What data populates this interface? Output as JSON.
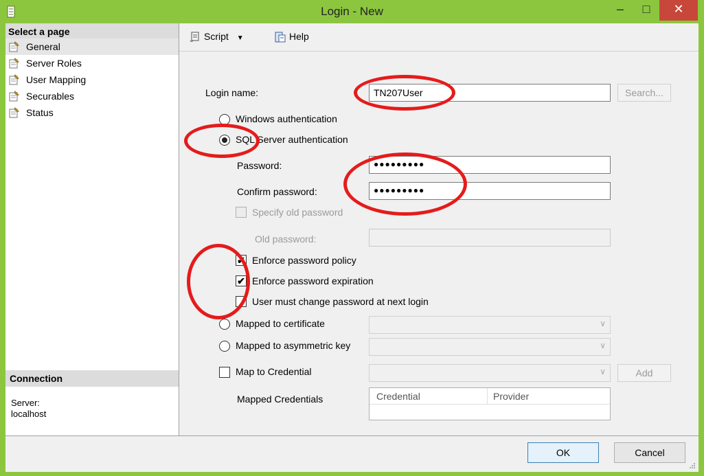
{
  "window": {
    "title": "Login - New",
    "minimize_glyph": "–",
    "maximize_glyph": "□",
    "close_glyph": "✕"
  },
  "left_pane": {
    "header": "Select a page",
    "pages": [
      "General",
      "Server Roles",
      "User Mapping",
      "Securables",
      "Status"
    ],
    "selected": "General",
    "connection_header": "Connection",
    "server_label": "Server:",
    "server_value": "localhost"
  },
  "toolbar": {
    "script_label": "Script",
    "dropdown_glyph": "▼",
    "help_label": "Help"
  },
  "form": {
    "login_name_label": "Login name:",
    "login_name_value": "TN207User",
    "search_button": "Search...",
    "windows_auth_label": "Windows authentication",
    "sql_auth_label": "SQL Server authentication",
    "password_label": "Password:",
    "password_value": "●●●●●●●●●",
    "confirm_password_label": "Confirm password:",
    "confirm_password_value": "●●●●●●●●●",
    "specify_old_password_label": "Specify old password",
    "old_password_label": "Old password:",
    "enforce_policy_label": "Enforce password policy",
    "enforce_expiration_label": "Enforce password expiration",
    "must_change_label": "User must change password at next login",
    "mapped_cert_label": "Mapped to certificate",
    "mapped_asym_label": "Mapped to asymmetric key",
    "map_credential_label": "Map to Credential",
    "add_button": "Add",
    "mapped_credentials_label": "Mapped Credentials",
    "grid_columns": [
      "Credential",
      "Provider"
    ],
    "check_glyph": "✔",
    "combo_arrow": "∨"
  },
  "footer": {
    "ok_button": "OK",
    "cancel_button": "Cancel"
  },
  "colors": {
    "frame": "#8cc63f",
    "close": "#c7483a",
    "annotation": "#e51b1b"
  }
}
